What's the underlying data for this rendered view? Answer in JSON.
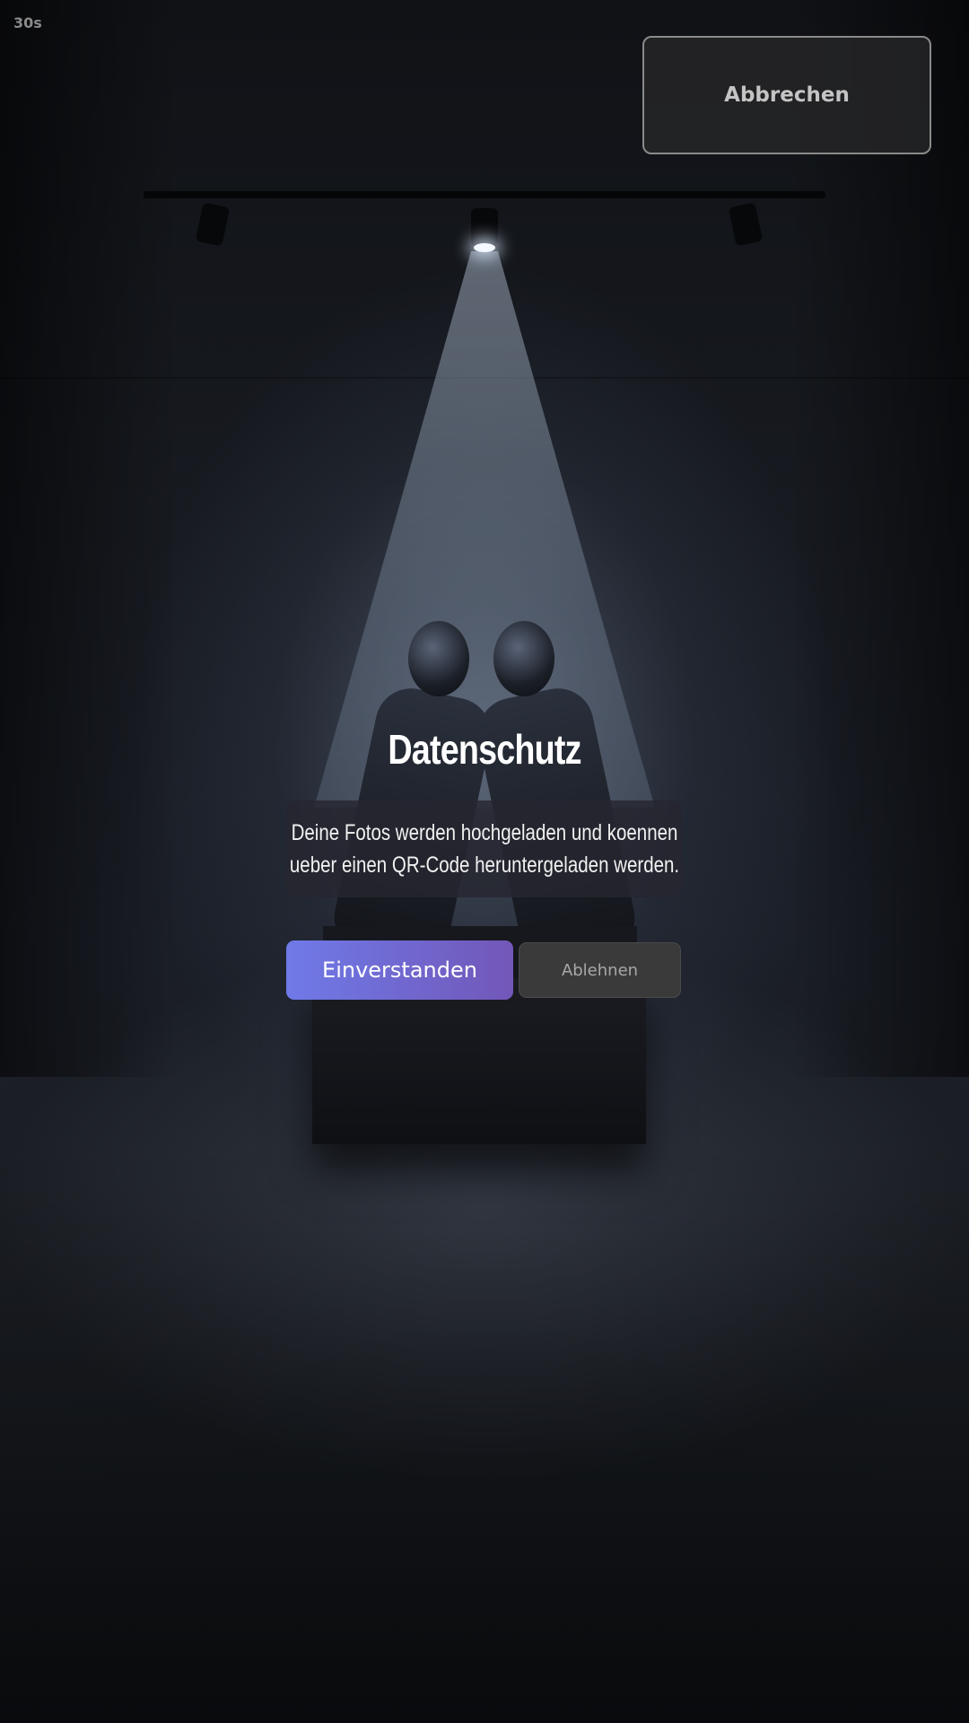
{
  "header": {
    "timer": "30s",
    "cancel_label": "Abbrechen"
  },
  "dialog": {
    "title": "Datenschutz",
    "message": "Deine Fotos werden hochgeladen und koennen\nueber einen QR-Code heruntergeladen werden.",
    "agree_label": "Einverstanden",
    "decline_label": "Ablehnen"
  },
  "colors": {
    "agree_gradient_start": "#6f7ae8",
    "agree_gradient_end": "#7257b8",
    "decline_background": "#3a3a3a",
    "cancel_border": "#8a8a8a"
  }
}
